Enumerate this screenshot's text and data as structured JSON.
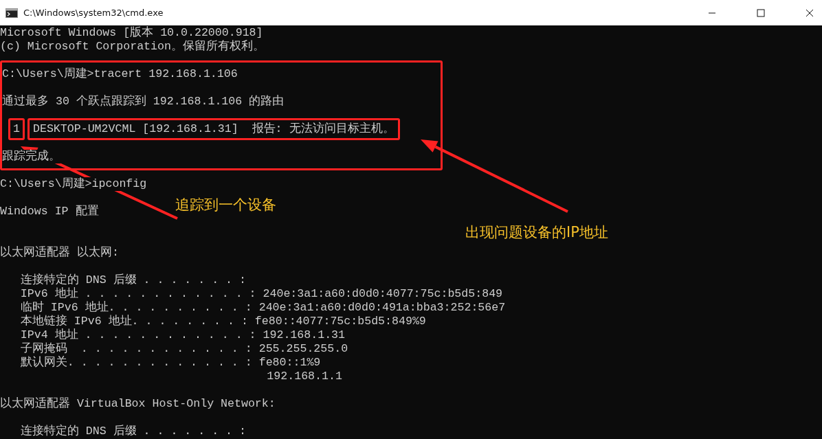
{
  "window": {
    "title": "C:\\Windows\\system32\\cmd.exe"
  },
  "sections": [
    {
      "highlighted": false,
      "lines": [
        {
          "kind": "text",
          "text": "Microsoft Windows [版本 10.0.22000.918]"
        },
        {
          "kind": "text",
          "text": "(c) Microsoft Corporation。保留所有权利。"
        },
        {
          "kind": "blank"
        }
      ]
    },
    {
      "highlighted": true,
      "lines": [
        {
          "kind": "text",
          "text": "C:\\Users\\周建>tracert 192.168.1.106"
        },
        {
          "kind": "blank"
        },
        {
          "kind": "text",
          "text": "通过最多 30 个跃点跟踪到 192.168.1.106 的路由"
        },
        {
          "kind": "blank"
        },
        {
          "kind": "hop",
          "hop": "1",
          "text": "DESKTOP-UM2VCML [192.168.1.31]  报告: 无法访问目标主机。"
        },
        {
          "kind": "blank"
        },
        {
          "kind": "text",
          "text": "跟踪完成。"
        }
      ]
    },
    {
      "highlighted": false,
      "lines": [
        {
          "kind": "blank"
        },
        {
          "kind": "text",
          "text": "C:\\Users\\周建>ipconfig"
        },
        {
          "kind": "blank"
        },
        {
          "kind": "text",
          "text": "Windows IP 配置"
        },
        {
          "kind": "blank"
        },
        {
          "kind": "blank"
        },
        {
          "kind": "text",
          "text": "以太网适配器 以太网:"
        },
        {
          "kind": "blank"
        },
        {
          "kind": "text",
          "text": "   连接特定的 DNS 后缀 . . . . . . . :"
        },
        {
          "kind": "text",
          "text": "   IPv6 地址 . . . . . . . . . . . . : 240e:3a1:a60:d0d0:4077:75c:b5d5:849"
        },
        {
          "kind": "text",
          "text": "   临时 IPv6 地址. . . . . . . . . . : 240e:3a1:a60:d0d0:491a:bba3:252:56e7"
        },
        {
          "kind": "text",
          "text": "   本地链接 IPv6 地址. . . . . . . . : fe80::4077:75c:b5d5:849%9"
        },
        {
          "kind": "text",
          "text": "   IPv4 地址 . . . . . . . . . . . . : 192.168.1.31"
        },
        {
          "kind": "text",
          "text": "   子网掩码  . . . . . . . . . . . . : 255.255.255.0"
        },
        {
          "kind": "text",
          "text": "   默认网关. . . . . . . . . . . . . : fe80::1%9"
        },
        {
          "kind": "text",
          "text": "                                       192.168.1.1"
        },
        {
          "kind": "blank"
        },
        {
          "kind": "text",
          "text": "以太网适配器 VirtualBox Host-Only Network:"
        },
        {
          "kind": "blank"
        },
        {
          "kind": "text",
          "text": "   连接特定的 DNS 后缀 . . . . . . . :"
        }
      ]
    }
  ],
  "annotations": [
    {
      "text": "追踪到一个设备"
    },
    {
      "text": "出现问题设备的IP地址"
    }
  ]
}
